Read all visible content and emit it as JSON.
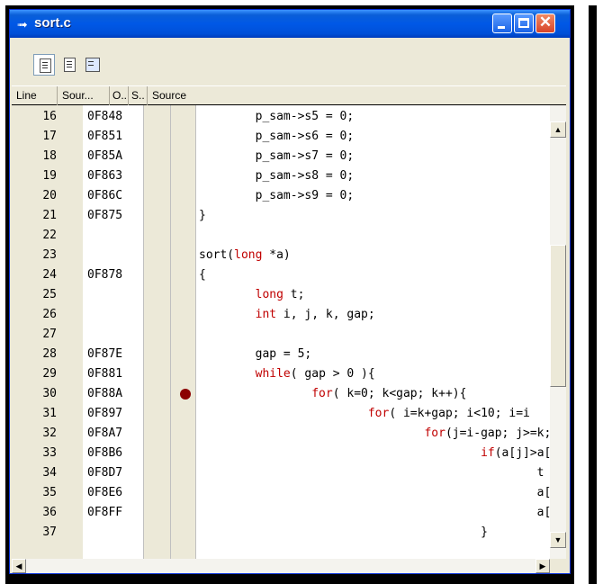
{
  "window": {
    "title": "sort.c"
  },
  "icons": {
    "title": "file-arrow-icon",
    "minimize": "minimize-icon",
    "maximize": "maximize-icon",
    "close": "close-icon"
  },
  "columns": [
    "Line",
    "Sour...",
    "O..",
    "S..",
    "Source"
  ],
  "rows": [
    {
      "line": "16",
      "addr": "0F848",
      "source": "        p_sam->s5 = 0;"
    },
    {
      "line": "17",
      "addr": "0F851",
      "source": "        p_sam->s6 = 0;"
    },
    {
      "line": "18",
      "addr": "0F85A",
      "source": "        p_sam->s7 = 0;"
    },
    {
      "line": "19",
      "addr": "0F863",
      "source": "        p_sam->s8 = 0;"
    },
    {
      "line": "20",
      "addr": "0F86C",
      "source": "        p_sam->s9 = 0;"
    },
    {
      "line": "21",
      "addr": "0F875",
      "source": "}"
    },
    {
      "line": "22",
      "addr": "",
      "source": ""
    },
    {
      "line": "23",
      "addr": "",
      "source": "sort(long *a)"
    },
    {
      "line": "24",
      "addr": "0F878",
      "source": "{"
    },
    {
      "line": "25",
      "addr": "",
      "source": "        long t;"
    },
    {
      "line": "26",
      "addr": "",
      "source": "        int i, j, k, gap;"
    },
    {
      "line": "27",
      "addr": "",
      "source": ""
    },
    {
      "line": "28",
      "addr": "0F87E",
      "source": "        gap = 5;"
    },
    {
      "line": "29",
      "addr": "0F881",
      "source": "        while( gap > 0 ){"
    },
    {
      "line": "30",
      "addr": "0F88A",
      "source": "                for( k=0; k<gap; k++){",
      "breakpoint": true
    },
    {
      "line": "31",
      "addr": "0F897",
      "source": "                        for( i=k+gap; i<10; i=i"
    },
    {
      "line": "32",
      "addr": "0F8A7",
      "source": "                                for(j=i-gap; j>=k;"
    },
    {
      "line": "33",
      "addr": "0F8B6",
      "source": "                                        if(a[j]>a[j+gap"
    },
    {
      "line": "34",
      "addr": "0F8D7",
      "source": "                                                t = a[j];"
    },
    {
      "line": "35",
      "addr": "0F8E6",
      "source": "                                                a[j] = a[j+"
    },
    {
      "line": "36",
      "addr": "0F8FF",
      "source": "                                                a[j+gap] = "
    },
    {
      "line": "37",
      "addr": "",
      "source": "                                        }"
    }
  ],
  "breakpoint_color": "#8b0000",
  "keyword_color": "#c00000"
}
